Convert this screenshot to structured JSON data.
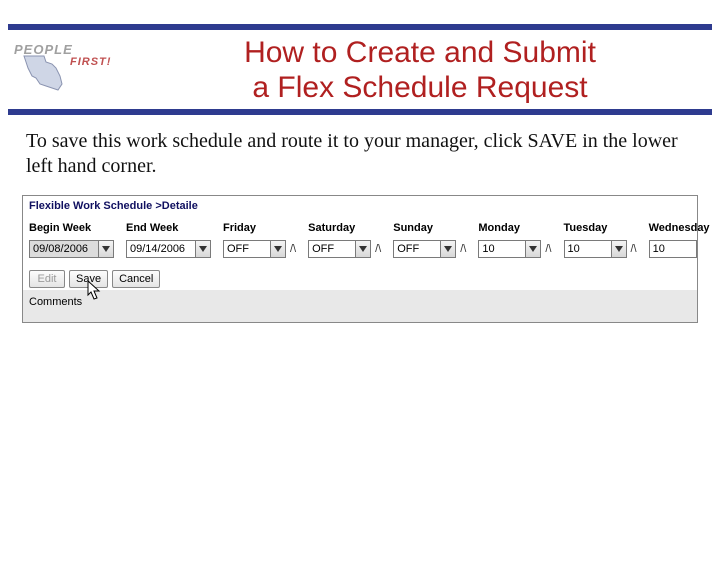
{
  "logo": {
    "people": "PEOPLE",
    "first": "FIRST!"
  },
  "title": {
    "line1": "How to Create and Submit",
    "line2": "a Flex Schedule Request"
  },
  "body_text": "To save this work schedule and route it to your manager, click SAVE in the lower left hand corner.",
  "app": {
    "heading": "Flexible Work Schedule >Detaile",
    "cols": {
      "begin_week": {
        "label": "Begin Week",
        "value": "09/08/2006"
      },
      "end_week": {
        "label": "End Week",
        "value": "09/14/2006"
      },
      "friday": {
        "label": "Friday",
        "value": "OFF"
      },
      "saturday": {
        "label": "Saturday",
        "value": "OFF"
      },
      "sunday": {
        "label": "Sunday",
        "value": "OFF"
      },
      "monday": {
        "label": "Monday",
        "value": "10"
      },
      "tuesday": {
        "label": "Tuesday",
        "value": "10"
      },
      "wednesday": {
        "label": "Wednesday",
        "value": "10"
      }
    },
    "buttons": {
      "edit": "Edit",
      "save": "Save",
      "cancel": "Cancel"
    },
    "comments_label": "Comments"
  }
}
